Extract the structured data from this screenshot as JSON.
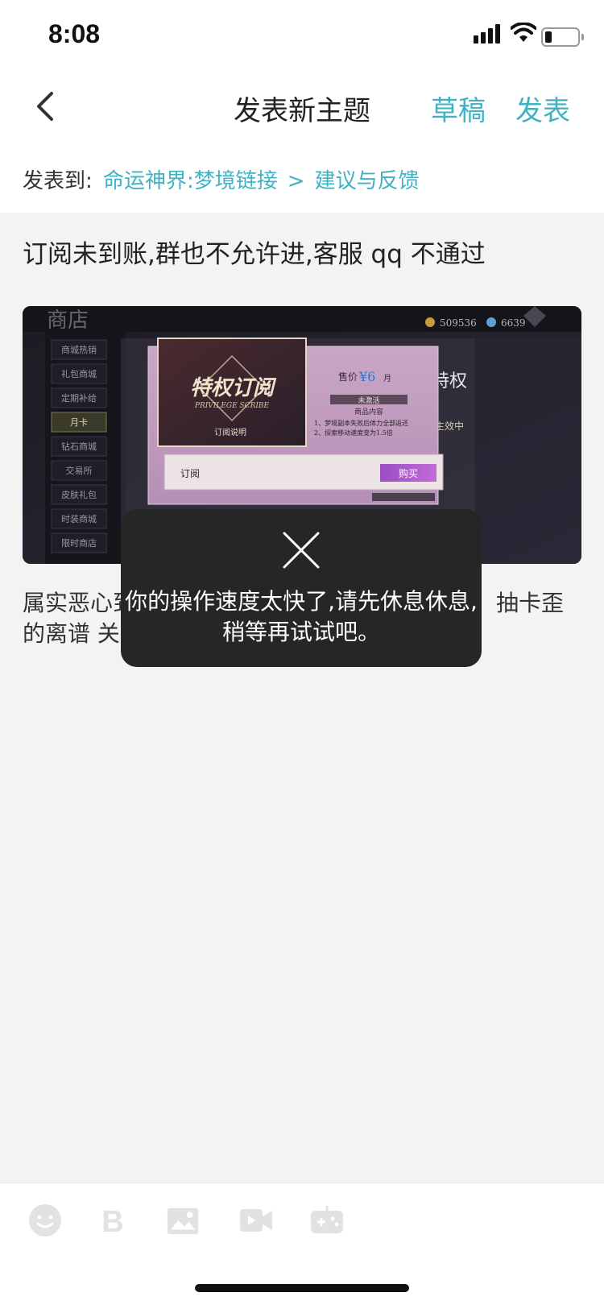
{
  "status_bar": {
    "time": "8:08"
  },
  "nav": {
    "title": "发表新主题",
    "draft_label": "草稿",
    "publish_label": "发表"
  },
  "post_to": {
    "label": "发表到:",
    "forum": "命运神界:梦境链接",
    "separator": ">",
    "section": "建议与反馈"
  },
  "post": {
    "title": "订阅未到账,群也不允许进,客服 qq 不通过",
    "body_line1_left": "属实恶心到",
    "body_line1_right": "抽卡歪",
    "body_line2_left": "的离谱 关"
  },
  "game_screenshot": {
    "header": "商店",
    "currency1": "509536",
    "currency2": "6639",
    "menu_items": [
      "商城热销",
      "礼包商城",
      "定期补给",
      "月卡",
      "钻石商城",
      "交易所",
      "皮肤礼包",
      "时装商城",
      "限时商店"
    ],
    "card_title": "特权订阅",
    "card_subtitle": "PRIVILEGE SCRIBE",
    "card_note": "订阅说明",
    "price_label": "售价",
    "price_value": "¥6",
    "price_unit": "月",
    "status": "未激活",
    "contents_label": "商品内容",
    "item1": "1、梦境副本失败后体力全部返还",
    "item2": "2、探索移动速度变为1.5倍",
    "right_title": "特权",
    "right_status": "生效中",
    "bar_label": "订阅",
    "buy_label": "购买"
  },
  "toast": {
    "message": "你的操作速度太快了,请先休息休息,稍等再试试吧。"
  },
  "toolbar": {
    "icons": [
      "emoji-icon",
      "bold-icon",
      "image-icon",
      "video-icon",
      "game-icon"
    ]
  },
  "colors": {
    "accent": "#3fb2c4",
    "toast_bg": "#262626",
    "page_bg": "#f3f3f3"
  }
}
